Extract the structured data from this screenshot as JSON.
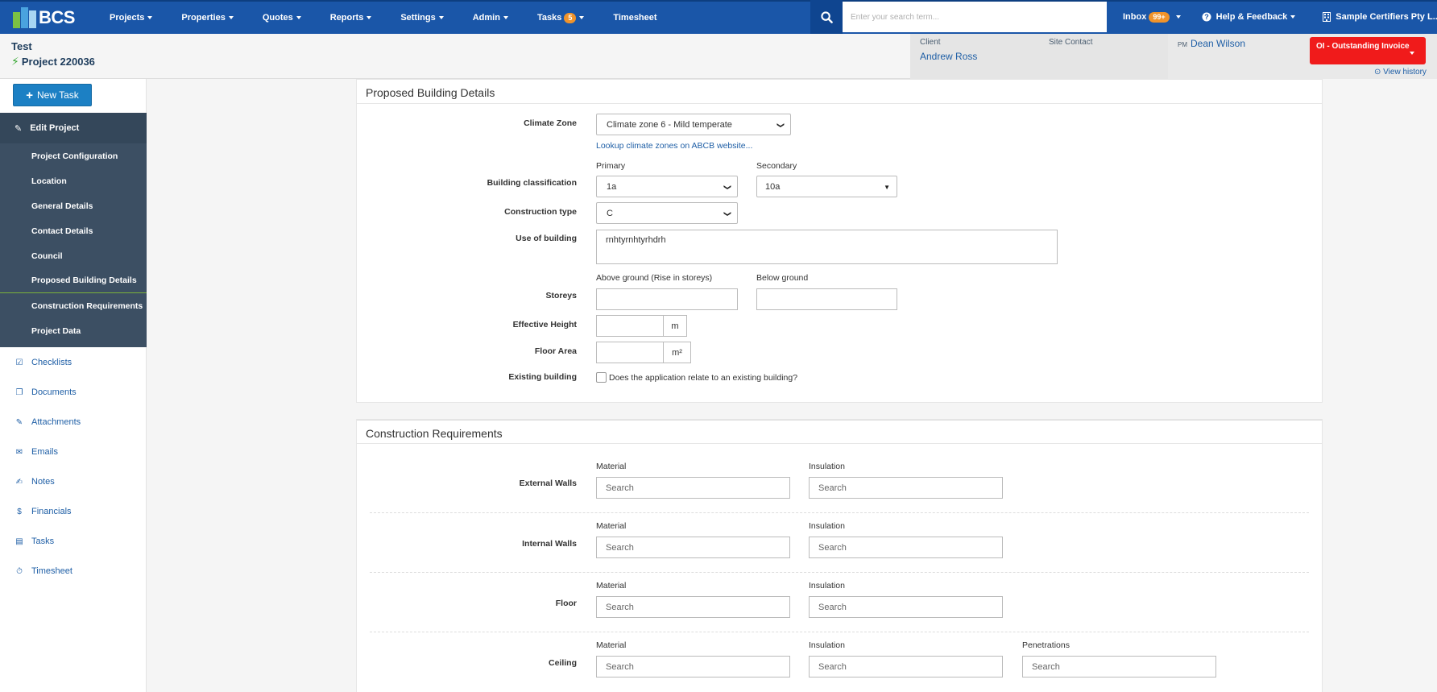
{
  "nav": {
    "logo": "BCS",
    "items": [
      "Projects",
      "Properties",
      "Quotes",
      "Reports",
      "Settings",
      "Admin"
    ],
    "tasks_label": "Tasks",
    "tasks_badge": "5",
    "timesheet": "Timesheet",
    "search_placeholder": "Enter your search term...",
    "inbox_label": "Inbox",
    "inbox_badge": "99+",
    "help": "Help & Feedback",
    "company": "Sample Certifiers Pty L..."
  },
  "project": {
    "name": "Test",
    "number": "Project 220036",
    "client_label": "Client",
    "client_value": "Andrew Ross",
    "site_contact_label": "Site Contact",
    "pm_label": "PM",
    "pm_value": "Dean Wilson",
    "status_button": "OI - Outstanding Invoice",
    "view_history": "View history"
  },
  "sidebar": {
    "new_task": "New Task",
    "edit_project": "Edit Project",
    "sub_items": [
      "Project Configuration",
      "Location",
      "General Details",
      "Contact Details",
      "Council",
      "Proposed Building Details",
      "Construction Requirements",
      "Project Data"
    ],
    "links": [
      "Checklists",
      "Documents",
      "Attachments",
      "Emails",
      "Notes",
      "Financials",
      "Tasks",
      "Timesheet"
    ]
  },
  "proposed": {
    "title": "Proposed Building Details",
    "climate_zone_label": "Climate Zone",
    "climate_zone_value": "Climate zone 6 - Mild temperate",
    "lookup_link": "Lookup climate zones on ABCB website...",
    "primary_label": "Primary",
    "secondary_label": "Secondary",
    "building_class_label": "Building classification",
    "primary_value": "1a",
    "secondary_value": "10a",
    "construction_type_label": "Construction type",
    "construction_type_value": "C",
    "use_label": "Use of building",
    "use_value": "rnhtyrnhtyrhdrh",
    "above_label": "Above ground (Rise in storeys)",
    "below_label": "Below ground",
    "storeys_label": "Storeys",
    "height_label": "Effective Height",
    "height_unit": "m",
    "floor_area_label": "Floor Area",
    "floor_area_unit": "m²",
    "existing_label": "Existing building",
    "existing_question": "Does the application relate to an existing building?"
  },
  "construction": {
    "title": "Construction Requirements",
    "material_label": "Material",
    "insulation_label": "Insulation",
    "penetrations_label": "Penetrations",
    "search_placeholder": "Search",
    "rows": [
      "External Walls",
      "Internal Walls",
      "Floor",
      "Ceiling"
    ]
  },
  "colors": {
    "nav_bg": "#1a56a8",
    "status_red": "#f01b1b",
    "sidebar_dark": "#3c4f63",
    "accent_green": "#7bb23a",
    "link_blue": "#1f5fa6"
  }
}
